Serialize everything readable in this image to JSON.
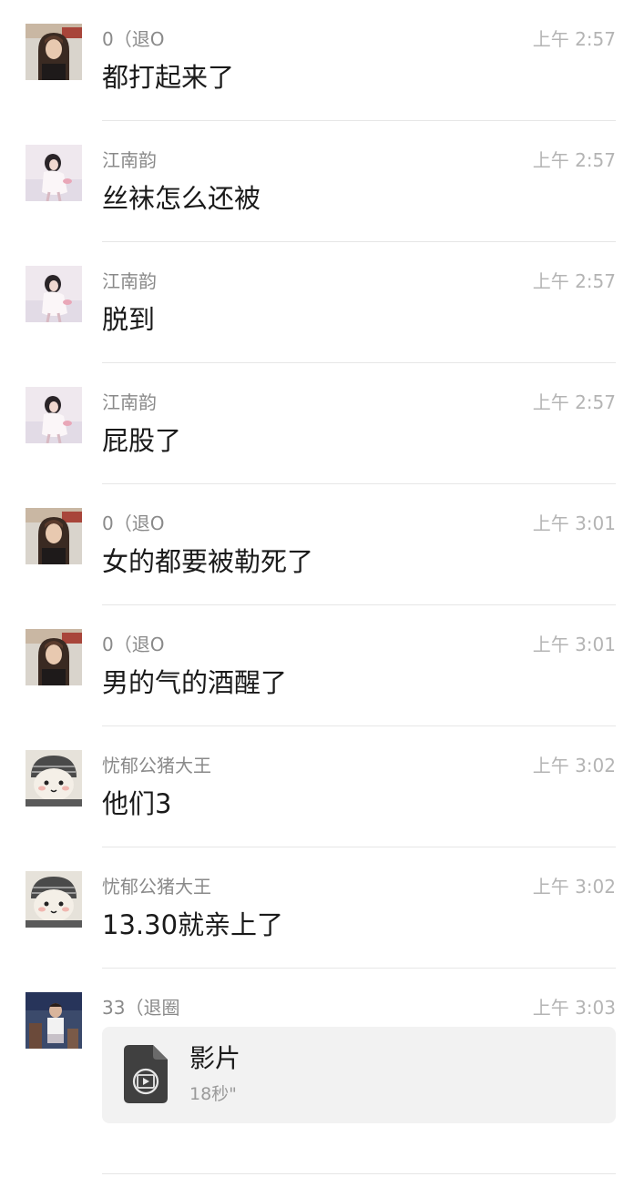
{
  "messages": [
    {
      "sender": "0（退O",
      "time": "上午 2:57",
      "text": "都打起来了",
      "avatar": "girl-dark-hair-avatar"
    },
    {
      "sender": "江南韵",
      "time": "上午 2:57",
      "text": "丝袜怎么还被",
      "avatar": "girl-white-dress-avatar"
    },
    {
      "sender": "江南韵",
      "time": "上午 2:57",
      "text": "脱到",
      "avatar": "girl-white-dress-avatar"
    },
    {
      "sender": "江南韵",
      "time": "上午 2:57",
      "text": "屁股了",
      "avatar": "girl-white-dress-avatar"
    },
    {
      "sender": "0（退O",
      "time": "上午 3:01",
      "text": "女的都要被勒死了",
      "avatar": "girl-dark-hair-avatar"
    },
    {
      "sender": "0（退O",
      "time": "上午 3:01",
      "text": "男的气的酒醒了",
      "avatar": "girl-dark-hair-avatar"
    },
    {
      "sender": "忧郁公猪大王",
      "time": "上午 3:02",
      "text": "他们3",
      "avatar": "plush-toy-avatar"
    },
    {
      "sender": "忧郁公猪大王",
      "time": "上午 3:02",
      "text": "13.30就亲上了",
      "avatar": "plush-toy-avatar"
    }
  ],
  "video_message": {
    "sender": "33（退圈",
    "time": "上午 3:03",
    "title": "影片",
    "duration": "18秒\"",
    "icon": "video-file-icon",
    "avatar": "child-photo-avatar"
  }
}
